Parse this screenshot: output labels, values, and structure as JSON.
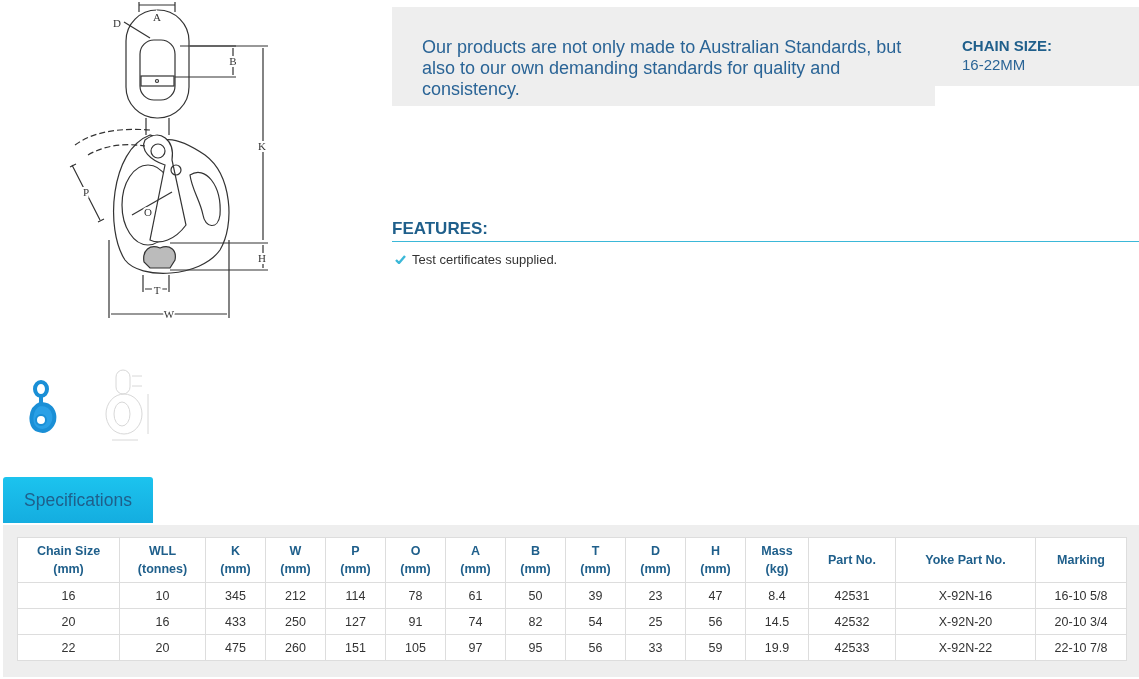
{
  "product_image": {
    "dimension_labels": [
      "D",
      "A",
      "B",
      "K",
      "P",
      "O",
      "H",
      "T",
      "W"
    ]
  },
  "intro": {
    "text": "Our products are not only made to Australian Standards, but also to our own demanding standards for quality and consistency.",
    "chain_size_label": "CHAIN SIZE:",
    "chain_size_value": "16-22MM"
  },
  "features": {
    "title": "FEATURES:",
    "items": [
      "Test certificates supplied."
    ]
  },
  "tabs": [
    {
      "label": "Specifications",
      "selected": true
    }
  ],
  "table": {
    "columns": [
      {
        "name": "Chain Size",
        "unit": "(mm)"
      },
      {
        "name": "WLL",
        "unit": "(tonnes)"
      },
      {
        "name": "K",
        "unit": "(mm)"
      },
      {
        "name": "W",
        "unit": "(mm)"
      },
      {
        "name": "P",
        "unit": "(mm)"
      },
      {
        "name": "O",
        "unit": "(mm)"
      },
      {
        "name": "A",
        "unit": "(mm)"
      },
      {
        "name": "B",
        "unit": "(mm)"
      },
      {
        "name": "T",
        "unit": "(mm)"
      },
      {
        "name": "D",
        "unit": "(mm)"
      },
      {
        "name": "H",
        "unit": "(mm)"
      },
      {
        "name": "Mass",
        "unit": "(kg)"
      },
      {
        "name": "Part No."
      },
      {
        "name": "Yoke Part No."
      },
      {
        "name": "Marking"
      }
    ],
    "rows": [
      [
        "16",
        "10",
        "345",
        "212",
        "114",
        "78",
        "61",
        "50",
        "39",
        "23",
        "47",
        "8.4",
        "42531",
        "X-92N-16",
        "16-10 5/8"
      ],
      [
        "20",
        "16",
        "433",
        "250",
        "127",
        "91",
        "74",
        "82",
        "54",
        "25",
        "56",
        "14.5",
        "42532",
        "X-92N-20",
        "20-10 3/4"
      ],
      [
        "22",
        "20",
        "475",
        "260",
        "151",
        "105",
        "97",
        "95",
        "56",
        "33",
        "59",
        "19.9",
        "42533",
        "X-92N-22",
        "22-10 7/8"
      ]
    ]
  }
}
